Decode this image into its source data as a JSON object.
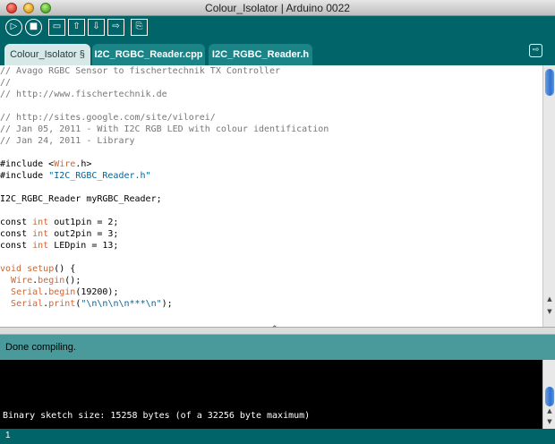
{
  "window": {
    "title": "Colour_Isolator | Arduino 0022"
  },
  "toolbar": {
    "buttons": [
      {
        "name": "verify-button",
        "icon": "▷"
      },
      {
        "name": "stop-button",
        "icon": "■"
      },
      {
        "name": "new-button",
        "icon": "▭"
      },
      {
        "name": "open-button",
        "icon": "⇧"
      },
      {
        "name": "save-button",
        "icon": "⇩"
      },
      {
        "name": "upload-button",
        "icon": "⇨"
      },
      {
        "name": "serial-monitor-button",
        "icon": "⎘"
      }
    ]
  },
  "tabs": [
    {
      "label": "Colour_Isolator §",
      "active": true
    },
    {
      "label": "I2C_RGBC_Reader.cpp",
      "active": false
    },
    {
      "label": "I2C_RGBC_Reader.h",
      "active": false
    }
  ],
  "tab_menu_icon": "⇨",
  "code": {
    "lines": [
      {
        "parts": [
          {
            "t": "// Avago RGBC Sensor to fischertechnik TX Controller",
            "c": "com"
          }
        ]
      },
      {
        "parts": [
          {
            "t": "//",
            "c": "com"
          }
        ]
      },
      {
        "parts": [
          {
            "t": "// http://www.fischertechnik.de",
            "c": "com"
          }
        ]
      },
      {
        "parts": []
      },
      {
        "parts": [
          {
            "t": "// http://sites.google.com/site/vilorei/",
            "c": "com"
          }
        ]
      },
      {
        "parts": [
          {
            "t": "// Jan 05, 2011 - With I2C RGB LED with colour identification",
            "c": "com"
          }
        ]
      },
      {
        "parts": [
          {
            "t": "// Jan 24, 2011 - Library",
            "c": "com"
          }
        ]
      },
      {
        "parts": []
      },
      {
        "parts": [
          {
            "t": "#include <",
            "c": ""
          },
          {
            "t": "Wire",
            "c": "kw"
          },
          {
            "t": ".h>",
            "c": ""
          }
        ]
      },
      {
        "parts": [
          {
            "t": "#include ",
            "c": ""
          },
          {
            "t": "\"I2C_RGBC_Reader.h\"",
            "c": "str"
          }
        ]
      },
      {
        "parts": []
      },
      {
        "parts": [
          {
            "t": "I2C_RGBC_Reader myRGBC_Reader;",
            "c": ""
          }
        ]
      },
      {
        "parts": []
      },
      {
        "parts": [
          {
            "t": "const ",
            "c": ""
          },
          {
            "t": "int",
            "c": "kw"
          },
          {
            "t": " out1pin = 2;",
            "c": ""
          }
        ]
      },
      {
        "parts": [
          {
            "t": "const ",
            "c": ""
          },
          {
            "t": "int",
            "c": "kw"
          },
          {
            "t": " out2pin = 3;",
            "c": ""
          }
        ]
      },
      {
        "parts": [
          {
            "t": "const ",
            "c": ""
          },
          {
            "t": "int",
            "c": "kw"
          },
          {
            "t": " LEDpin = 13;",
            "c": ""
          }
        ]
      },
      {
        "parts": []
      },
      {
        "parts": [
          {
            "t": "void",
            "c": "kw"
          },
          {
            "t": " ",
            "c": ""
          },
          {
            "t": "setup",
            "c": "kw"
          },
          {
            "t": "() {",
            "c": ""
          }
        ]
      },
      {
        "parts": [
          {
            "t": "  ",
            "c": ""
          },
          {
            "t": "Wire",
            "c": "kw"
          },
          {
            "t": ".",
            "c": ""
          },
          {
            "t": "begin",
            "c": "kw"
          },
          {
            "t": "();",
            "c": ""
          }
        ]
      },
      {
        "parts": [
          {
            "t": "  ",
            "c": ""
          },
          {
            "t": "Serial",
            "c": "kw"
          },
          {
            "t": ".",
            "c": ""
          },
          {
            "t": "begin",
            "c": "kw"
          },
          {
            "t": "(19200);",
            "c": ""
          }
        ]
      },
      {
        "parts": [
          {
            "t": "  ",
            "c": ""
          },
          {
            "t": "Serial",
            "c": "kw"
          },
          {
            "t": ".",
            "c": ""
          },
          {
            "t": "print",
            "c": "kw"
          },
          {
            "t": "(",
            "c": ""
          },
          {
            "t": "\"\\n\\n\\n\\n***\\n\"",
            "c": "str"
          },
          {
            "t": ");",
            "c": ""
          }
        ]
      }
    ]
  },
  "status": {
    "message": "Done compiling."
  },
  "console": {
    "output": "Binary sketch size: 15258 bytes (of a 32256 byte maximum)"
  },
  "bottom": {
    "line_number": "1"
  },
  "colors": {
    "accent": "#006468",
    "status_bg": "#4a9a9c",
    "comment": "#777777",
    "keyword": "#cc6633",
    "string": "#006699"
  }
}
